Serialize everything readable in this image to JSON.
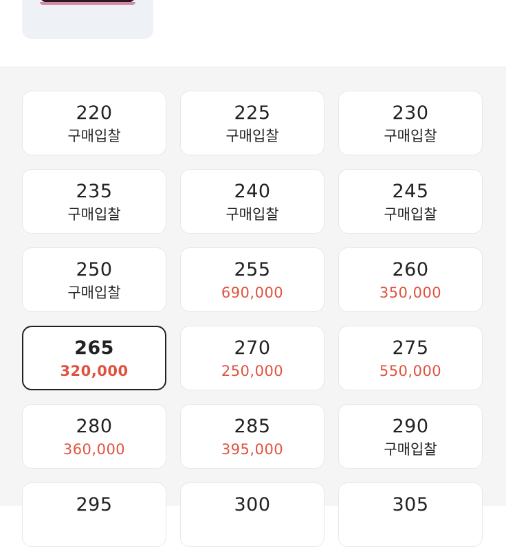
{
  "colors": {
    "price_red": "#e0523f",
    "text": "#222222",
    "background": "#f5f5f5"
  },
  "product_thumbnail": {
    "icon": "shoe-image"
  },
  "sizes": [
    {
      "size": "220",
      "label": "구매입찰",
      "type": "bid"
    },
    {
      "size": "225",
      "label": "구매입찰",
      "type": "bid"
    },
    {
      "size": "230",
      "label": "구매입찰",
      "type": "bid"
    },
    {
      "size": "235",
      "label": "구매입찰",
      "type": "bid"
    },
    {
      "size": "240",
      "label": "구매입찰",
      "type": "bid"
    },
    {
      "size": "245",
      "label": "구매입찰",
      "type": "bid"
    },
    {
      "size": "250",
      "label": "구매입찰",
      "type": "bid"
    },
    {
      "size": "255",
      "label": "690,000",
      "type": "price"
    },
    {
      "size": "260",
      "label": "350,000",
      "type": "price"
    },
    {
      "size": "265",
      "label": "320,000",
      "type": "price",
      "selected": true
    },
    {
      "size": "270",
      "label": "250,000",
      "type": "price"
    },
    {
      "size": "275",
      "label": "550,000",
      "type": "price"
    },
    {
      "size": "280",
      "label": "360,000",
      "type": "price"
    },
    {
      "size": "285",
      "label": "395,000",
      "type": "price"
    },
    {
      "size": "290",
      "label": "구매입찰",
      "type": "bid"
    },
    {
      "size": "295",
      "label": "",
      "type": "unknown"
    },
    {
      "size": "300",
      "label": "",
      "type": "unknown"
    },
    {
      "size": "305",
      "label": "",
      "type": "unknown"
    }
  ]
}
